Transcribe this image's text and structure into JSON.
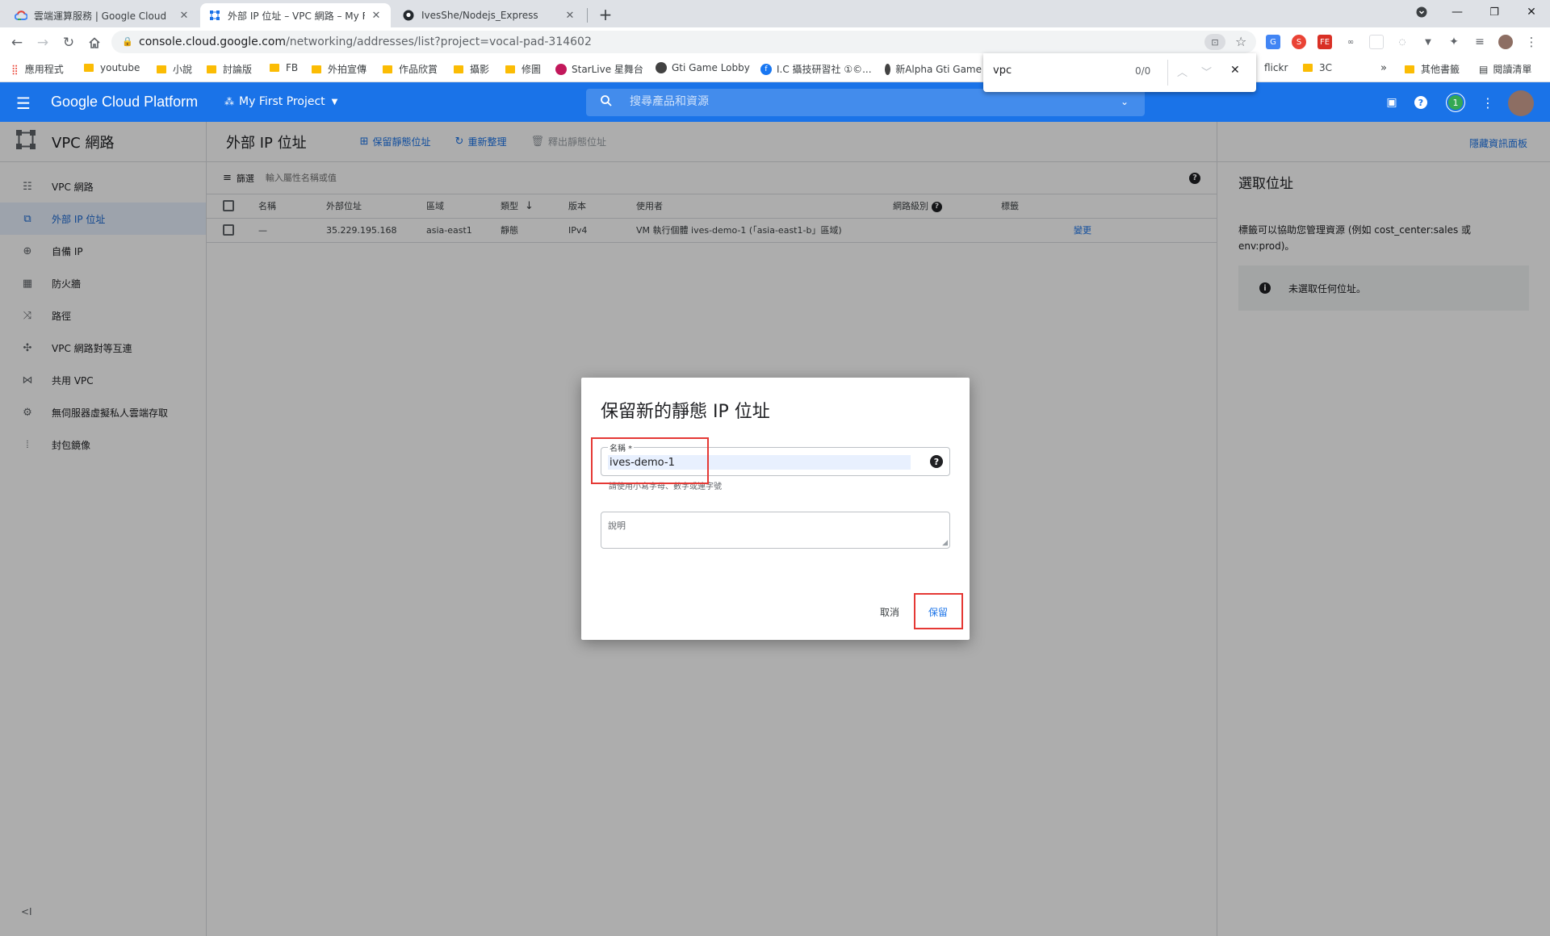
{
  "browser": {
    "tabs": [
      {
        "title": "雲端運算服務 | Google Cloud",
        "icon": "google-cloud-icon"
      },
      {
        "title": "外部 IP 位址 – VPC 網路 – My First Project",
        "icon": "vpc-network-icon"
      },
      {
        "title": "IvesShe/Nodejs_Express",
        "icon": "github-icon"
      }
    ],
    "new_tab": "+",
    "url_host": "console.cloud.google.com",
    "url_path": "/networking/addresses/list?project=vocal-pad-314602",
    "bookmarks": [
      "應用程式",
      "youtube",
      "小說",
      "討論版",
      "FB",
      "外拍宣傳",
      "作品欣賞",
      "攝影",
      "修圖",
      "StarLive 星舞台",
      "Gti Game Lobby",
      "I.C 攝技研習社 ①©...",
      "新Alpha Gti Game",
      "flickr",
      "3C"
    ],
    "bookmarks_overflow": "»",
    "bookmarks_other": "其他書籤",
    "reading_list": "閱讀清單",
    "find": {
      "query": "vpc",
      "count": "0/0"
    }
  },
  "gcp": {
    "product": "Google Cloud Platform",
    "project": "My First Project",
    "search_placeholder": "搜尋產品和資源",
    "notification_count": "1"
  },
  "sidebar": {
    "title": "VPC 網路",
    "items": [
      {
        "label": "VPC 網路",
        "icon": "vpc-icon"
      },
      {
        "label": "外部 IP 位址",
        "icon": "external-ip-icon"
      },
      {
        "label": "自備 IP",
        "icon": "globe-icon"
      },
      {
        "label": "防火牆",
        "icon": "firewall-icon"
      },
      {
        "label": "路徑",
        "icon": "routes-icon"
      },
      {
        "label": "VPC 網路對等互連",
        "icon": "peering-icon"
      },
      {
        "label": "共用 VPC",
        "icon": "shared-vpc-icon"
      },
      {
        "label": "無伺服器虛擬私人雲端存取",
        "icon": "serverless-icon"
      },
      {
        "label": "封包鏡像",
        "icon": "packet-mirroring-icon"
      }
    ],
    "collapse": "<I"
  },
  "page": {
    "title": "外部 IP 位址",
    "actions": {
      "reserve": "保留靜態位址",
      "refresh": "重新整理",
      "release": "釋出靜態位址"
    },
    "hide_panel": "隱藏資訊面板",
    "filter_label": "篩選",
    "filter_placeholder": "輸入屬性名稱或值"
  },
  "table": {
    "columns": [
      "名稱",
      "外部位址",
      "區域",
      "類型",
      "版本",
      "使用者",
      "網路級別",
      "標籤"
    ],
    "rows": [
      {
        "name": "—",
        "address": "35.229.195.168",
        "region": "asia-east1",
        "type": "靜態",
        "version": "IPv4",
        "user": "VM 執行個體 ives-demo-1 (「asia-east1-b」區域)",
        "tier": "",
        "labels": "",
        "action": "變更"
      }
    ]
  },
  "info_panel": {
    "title": "選取位址",
    "desc": "標籤可以協助您管理資源 (例如 cost_center:sales 或 env:prod)。",
    "notice": "未選取任何位址。"
  },
  "dialog": {
    "title": "保留新的靜態 IP 位址",
    "name_label": "名稱 *",
    "name_value": "ives-demo-1",
    "name_hint": "請使用小寫字母、數字或連字號",
    "desc_placeholder": "說明",
    "cancel": "取消",
    "reserve": "保留"
  },
  "colors": {
    "brand": "#1a73e8",
    "highlight": "#e53935"
  }
}
